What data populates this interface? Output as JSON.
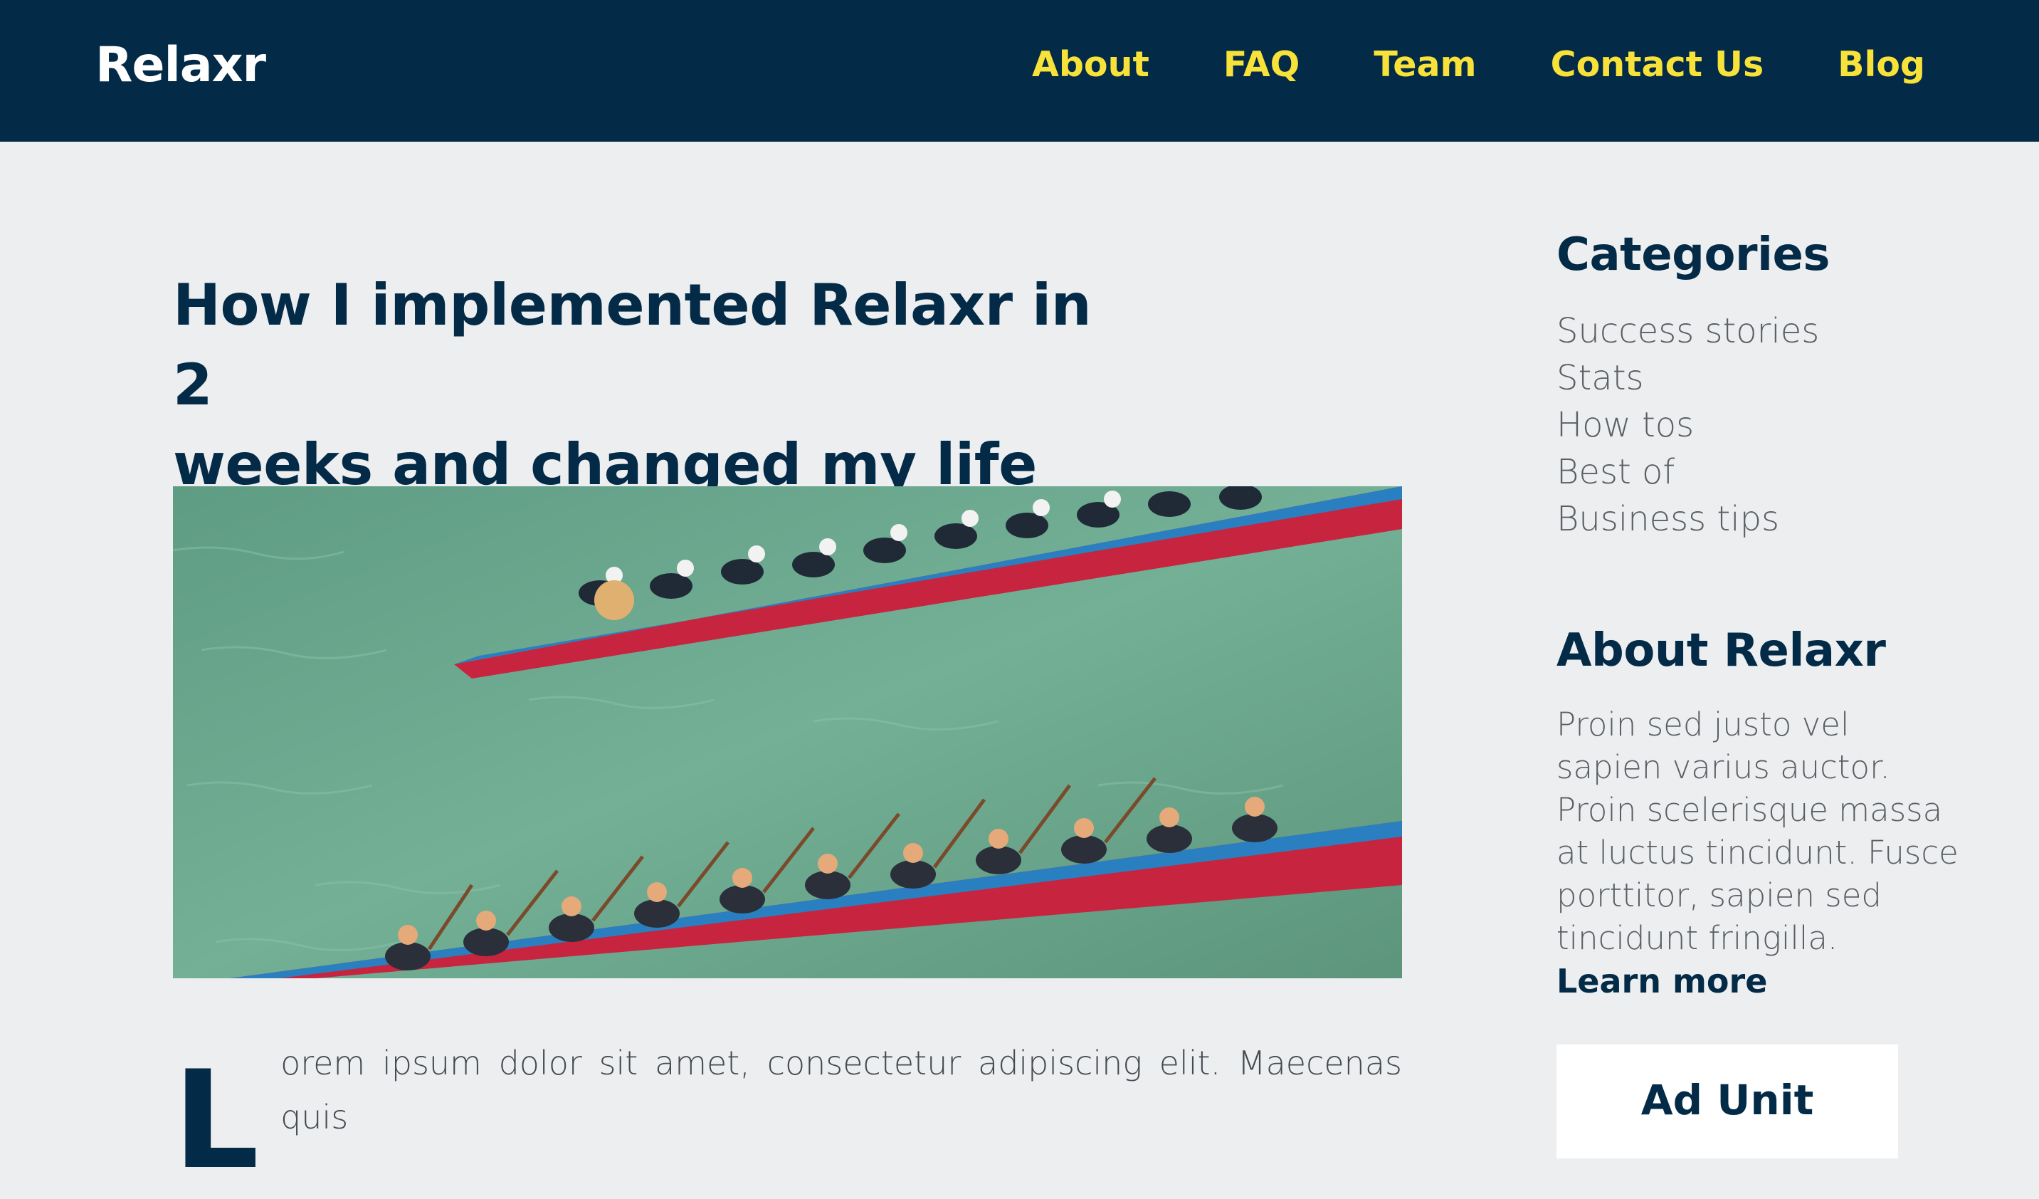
{
  "brand": "Relaxr",
  "nav": [
    {
      "label": "About"
    },
    {
      "label": "FAQ"
    },
    {
      "label": "Team"
    },
    {
      "label": "Contact Us"
    },
    {
      "label": "Blog"
    }
  ],
  "post": {
    "title_line1": "How I implemented Relaxr in 2",
    "title_line2": "weeks and changed my life",
    "hero_alt": "dragon-boat-race-photo",
    "dropcap": "L",
    "body_line1": "orem ipsum dolor sit amet, consectetur adipiscing elit. Maecenas quis"
  },
  "sidebar": {
    "categories_heading": "Categories",
    "categories": [
      {
        "label": "Success stories"
      },
      {
        "label": "Stats"
      },
      {
        "label": "How tos"
      },
      {
        "label": "Best of"
      },
      {
        "label": "Business tips"
      }
    ],
    "about_heading": "About Relaxr",
    "about_text": "Proin sed justo vel sapien varius auctor. Proin scelerisque massa at luctus tincidunt. Fusce porttitor, sapien sed tincidunt fringilla.",
    "learn_more": "Learn more",
    "ad_label": "Ad Unit"
  },
  "colors": {
    "navbar_bg": "#032a46",
    "nav_link": "#f8e23a",
    "page_bg": "#eceef0",
    "heading": "#032a46"
  }
}
